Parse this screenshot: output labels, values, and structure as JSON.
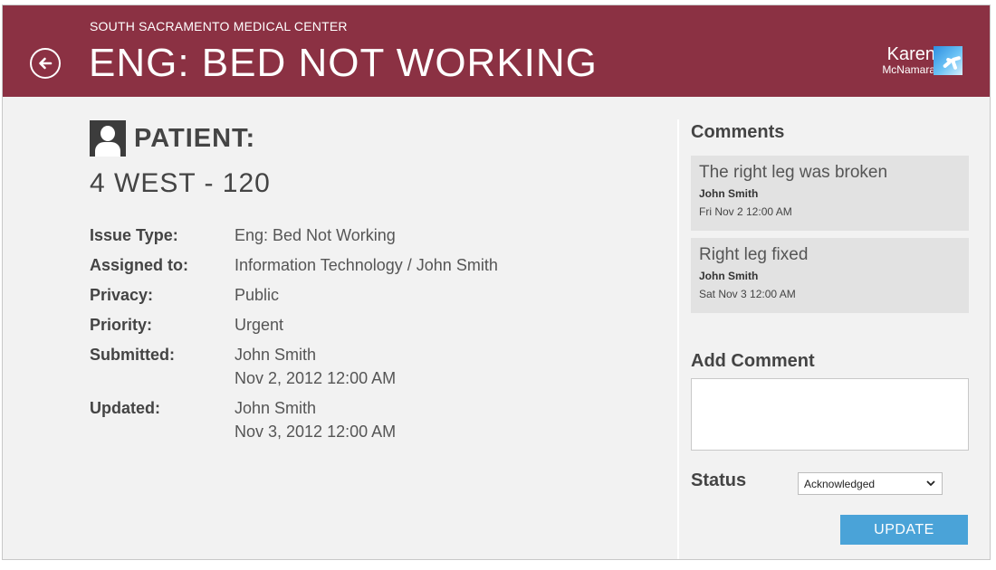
{
  "header": {
    "org_name": "SOUTH SACRAMENTO MEDICAL CENTER",
    "title": "ENG: BED NOT WORKING",
    "user_first": "Karen",
    "user_last": "McNamara",
    "back_icon": "back-arrow-icon",
    "color": "#8b3143"
  },
  "patient": {
    "label": "PATIENT:",
    "location": "4 WEST - 120",
    "icon": "person-icon"
  },
  "details": [
    {
      "label": "Issue Type:",
      "value": "Eng: Bed Not Working"
    },
    {
      "label": "Assigned to:",
      "value": "Information Technology / John Smith"
    },
    {
      "label": "Privacy:",
      "value": "Public"
    },
    {
      "label": "Priority:",
      "value": "Urgent"
    },
    {
      "label": "Submitted:",
      "value": "John Smith",
      "value2": "Nov 2, 2012 12:00 AM"
    },
    {
      "label": "Updated:",
      "value": "John Smith",
      "value2": "Nov 3, 2012 12:00 AM"
    }
  ],
  "comments": {
    "title": "Comments",
    "items": [
      {
        "text": "The right leg was broken",
        "author": "John Smith",
        "time": "Fri Nov 2 12:00 AM"
      },
      {
        "text": "Right leg fixed",
        "author": "John Smith",
        "time": "Sat Nov 3 12:00 AM"
      }
    ]
  },
  "add_comment": {
    "title": "Add Comment",
    "value": "",
    "placeholder": ""
  },
  "status": {
    "label": "Status",
    "selected": "Acknowledged"
  },
  "update_button": {
    "label": "UPDATE",
    "color": "#4aa3d8"
  }
}
